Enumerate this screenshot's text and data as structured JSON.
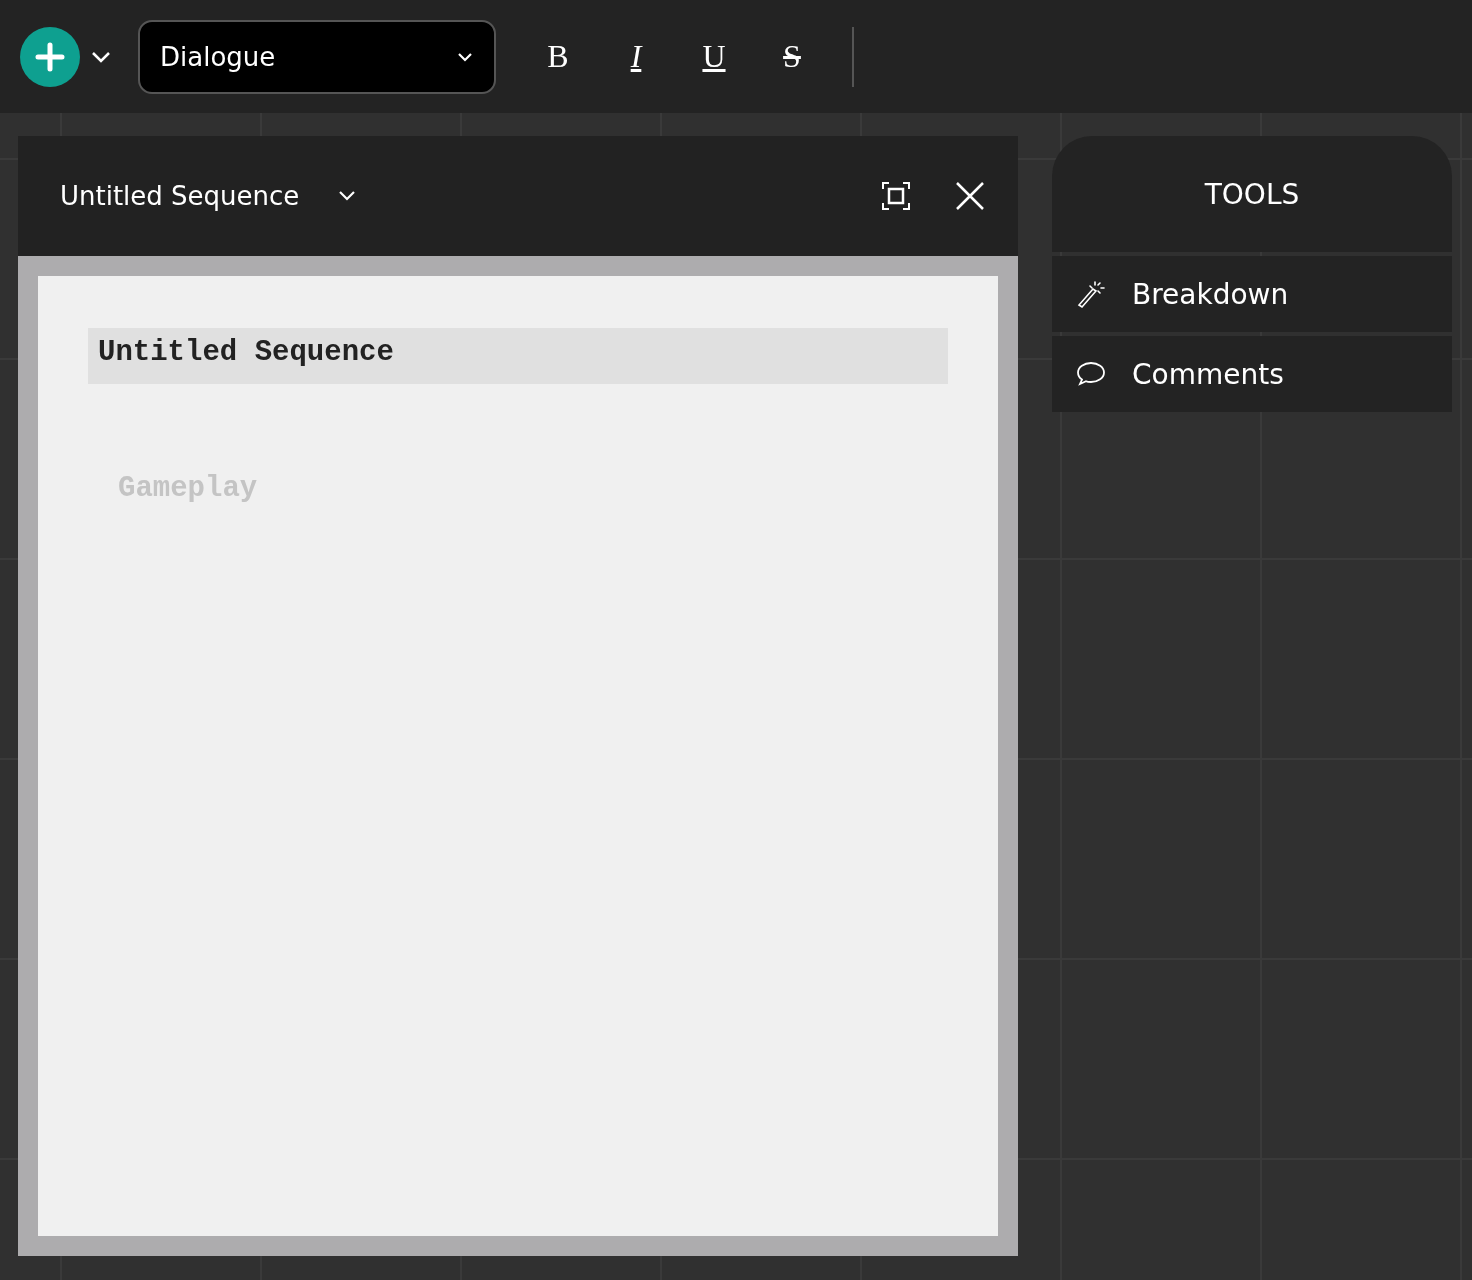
{
  "toolbar": {
    "element_type": {
      "value": "Dialogue"
    },
    "format_buttons": [
      {
        "kind": "bold",
        "label": "B"
      },
      {
        "kind": "italic",
        "label": "I"
      },
      {
        "kind": "underline",
        "label": "U"
      },
      {
        "kind": "strike",
        "label": "S"
      }
    ]
  },
  "editor": {
    "title": "Untitled Sequence",
    "page": {
      "heading": "Untitled Sequence",
      "placeholder": "Gameplay"
    }
  },
  "tools": {
    "title": "TOOLS",
    "items": [
      {
        "kind": "wand",
        "label": "Breakdown"
      },
      {
        "kind": "comment",
        "label": "Comments"
      }
    ]
  }
}
